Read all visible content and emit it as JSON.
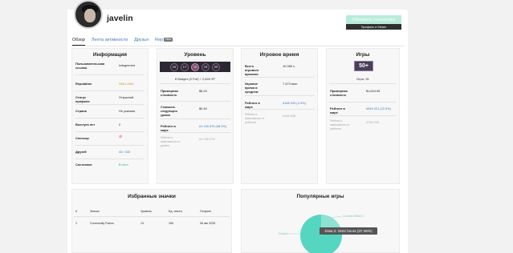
{
  "header": {
    "username": "javelin",
    "refresh_label": "Обновить статистику",
    "steam_profile_label": "Профиль в Steam"
  },
  "tabs": [
    {
      "label": "Обзор"
    },
    {
      "label": "Лента активности"
    },
    {
      "label": "Друзья"
    },
    {
      "label": "Rep",
      "badge": "New"
    }
  ],
  "info": {
    "title": "Информация",
    "rows": [
      {
        "label": "Пользовательская ссылка",
        "value": "ixdsgmmed"
      },
      {
        "label": "Reputation",
        "value": "SKILL/VAL"
      },
      {
        "label": "Статус профиля",
        "value": "Открытый"
      },
      {
        "label": "Страна",
        "value": "Не указана"
      },
      {
        "label": "Выслуга лет",
        "value": "2"
      },
      {
        "label": "Спонсор",
        "value": "⊘"
      },
      {
        "label": "Друзей",
        "value": "43 / 340"
      },
      {
        "label": "Состояние",
        "value": "В сети"
      }
    ]
  },
  "level": {
    "title": "Уровень",
    "levels": [
      "16",
      "17",
      "18",
      "19",
      "20"
    ],
    "current_level": "18",
    "summary": "8 Badges (0 Foil) + 2,628 XP",
    "rows": [
      {
        "label": "Примерная стоимость",
        "value": "$5.25"
      },
      {
        "label": "Стоимость следующего уровня",
        "value": "$0.40"
      },
      {
        "label": "Рейтинг в мире",
        "value": "#1 150 675 (38.0%)"
      },
      {
        "label": "Рейтинг в зависимости от уровня",
        "value": "#1 140 273"
      }
    ]
  },
  "playtime": {
    "title": "Игровое время",
    "rows": [
      {
        "label": "Всего игрового времени",
        "value": "10 089 ч."
      },
      {
        "label": "Игровое время в среднем",
        "value": "7 473 мин."
      },
      {
        "label": "Рейтинг в мире",
        "value": "#168 943 (4.4%)"
      },
      {
        "label": "Рейтинг в зависимости от рейтинга",
        "value": "#116 645"
      }
    ]
  },
  "games": {
    "title": "Игры",
    "badge": "50+",
    "count_label": "Игры: 81",
    "rows": [
      {
        "label": "Примерная стоимость",
        "value": "$1,624.05"
      },
      {
        "label": "Рейтинг в мире",
        "value": "#549 221 (22.0%)"
      },
      {
        "label": "Рейтинг в зависимости от рейтинга",
        "value": "#745 243"
      }
    ]
  },
  "badges": {
    "title": "Избранные значки",
    "columns": [
      "#",
      "Значок",
      "Уровень",
      "Ед. опыта",
      "Получен"
    ],
    "rows": [
      {
        "num": "1",
        "name": "Community Patron",
        "level": "13",
        "xp": "150",
        "date": "06 авг 2025"
      }
    ]
  },
  "popular_games": {
    "title": "Популярные игры",
    "tooltip": "Dota 2: 1522 hours (37.36%)",
    "labels": [
      "Counter-Strike 2",
      "Dota 2"
    ],
    "chart_data": {
      "type": "pie",
      "categories": [
        "Dota 2"
      ],
      "values": [
        37.36
      ]
    }
  },
  "colors": {
    "accent": "#3d7bbd",
    "refresh_button": "#b8ecd9",
    "pie_main": "#55d6c1",
    "pie_secondary": "#8ee2d2",
    "online": "#2fb08a",
    "reputation": "#e08a00"
  }
}
